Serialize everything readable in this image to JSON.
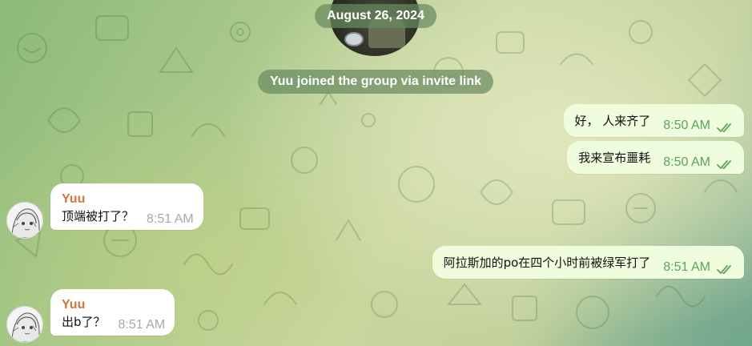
{
  "chat": {
    "date_label": "August 26, 2024",
    "service_message": "Yuu joined the group via invite link"
  },
  "messages": [
    {
      "direction": "out",
      "text": "好， 人来齐了",
      "time": "8:50 AM",
      "status": "read"
    },
    {
      "direction": "out",
      "text": "我来宣布噩耗",
      "time": "8:50 AM",
      "status": "read"
    },
    {
      "direction": "in",
      "sender": "Yuu",
      "text": "顶端被打了？",
      "time": "8:51 AM"
    },
    {
      "direction": "out",
      "text": "阿拉斯加的po在四个小时前被绿军打了",
      "time": "8:51 AM",
      "status": "read"
    },
    {
      "direction": "in",
      "sender": "Yuu",
      "text": "出b了？",
      "time": "8:51 AM"
    }
  ],
  "colors": {
    "outgoing_bubble": "#effdde",
    "outgoing_meta": "#5ea25c",
    "incoming_bubble": "#ffffff",
    "sender_name": "#d2763b",
    "incoming_meta": "#a3a9b2",
    "service_pill": "#688a60"
  },
  "icons": {
    "read_status": "double-check-icon",
    "avatar": "anime-avatar-icon"
  }
}
